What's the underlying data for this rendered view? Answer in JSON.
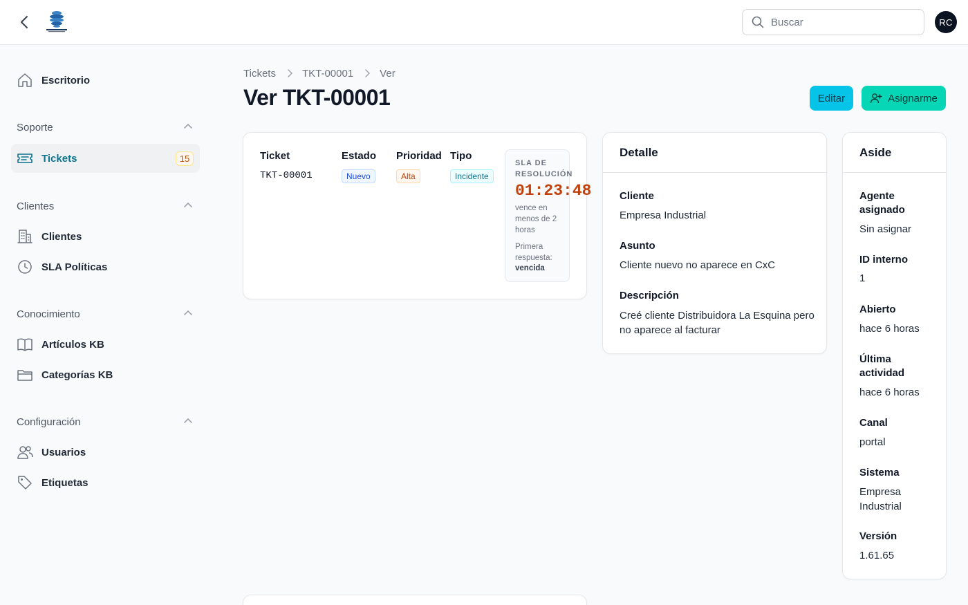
{
  "topbar": {
    "search_placeholder": "Buscar",
    "avatar_initials": "RC",
    "logo_icon": "hightech-globe-logo"
  },
  "sidebar": {
    "top_items": [
      {
        "label": "Escritorio",
        "icon": "home-icon"
      }
    ],
    "groups": [
      {
        "label": "Soporte",
        "items": [
          {
            "label": "Tickets",
            "icon": "ticket-icon",
            "count": "15",
            "active": true
          }
        ]
      },
      {
        "label": "Clientes",
        "items": [
          {
            "label": "Clientes",
            "icon": "building-icon"
          },
          {
            "label": "SLA Políticas",
            "icon": "clock-icon"
          }
        ]
      },
      {
        "label": "Conocimiento",
        "items": [
          {
            "label": "Artículos KB",
            "icon": "book-icon"
          },
          {
            "label": "Categorías KB",
            "icon": "folder-icon"
          }
        ]
      },
      {
        "label": "Configuración",
        "items": [
          {
            "label": "Usuarios",
            "icon": "users-icon"
          },
          {
            "label": "Etiquetas",
            "icon": "tag-icon"
          }
        ]
      }
    ]
  },
  "breadcrumb": [
    "Tickets",
    "TKT-00001",
    "Ver"
  ],
  "page": {
    "title": "Ver TKT-00001",
    "edit_label": "Editar",
    "assign_label": "Asignarme"
  },
  "ticket_card": {
    "ticket_label": "Ticket",
    "ticket_value": "TKT-00001",
    "estado_label": "Estado",
    "estado_value": "Nuevo",
    "prioridad_label": "Prioridad",
    "prioridad_value": "Alta",
    "tipo_label": "Tipo",
    "tipo_value": "Incidente",
    "sla": {
      "title": "SLA DE RESOLUCIÓN",
      "time": "01:23:48",
      "note": "vence en menos de 2 horas",
      "first_response_label": "Primera respuesta:",
      "first_response_value": "vencida"
    }
  },
  "detalle": {
    "title": "Detalle",
    "cliente_label": "Cliente",
    "cliente_value": "Empresa Industrial",
    "asunto_label": "Asunto",
    "asunto_value": "Cliente nuevo no aparece en CxC",
    "descripcion_label": "Descripción",
    "descripcion_value": "Creé cliente Distribuidora La Esquina pero no aparece al facturar"
  },
  "aside": {
    "title": "Aside",
    "agente_label": "Agente asignado",
    "agente_value": "Sin asignar",
    "id_label": "ID interno",
    "id_value": "1",
    "abierto_label": "Abierto",
    "abierto_value": "hace 6 horas",
    "ultima_label": "Última actividad",
    "ultima_value": "hace 6 horas",
    "canal_label": "Canal",
    "canal_value": "portal",
    "sistema_label": "Sistema",
    "sistema_value": "Empresa Industrial",
    "version_label": "Versión",
    "version_value": "1.61.65"
  }
}
